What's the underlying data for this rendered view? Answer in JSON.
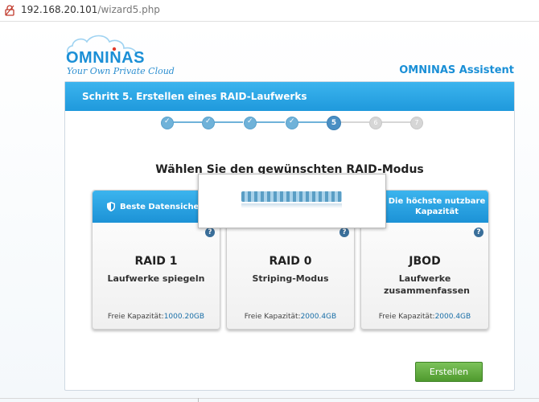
{
  "browser": {
    "url_host": "192.168.20.101",
    "url_path": "/wizard5.php"
  },
  "header": {
    "logo_text": "OMNINAS",
    "tagline": "Your Own Private Cloud",
    "assistant_title": "OMNINAS Assistent"
  },
  "wizard": {
    "step_title": "Schritt 5. Erstellen eines RAID-Laufwerks",
    "steps": [
      {
        "label": "✓",
        "state": "done"
      },
      {
        "label": "✓",
        "state": "done"
      },
      {
        "label": "✓",
        "state": "done"
      },
      {
        "label": "✓",
        "state": "done"
      },
      {
        "label": "5",
        "state": "current"
      },
      {
        "label": "6",
        "state": "todo"
      },
      {
        "label": "7",
        "state": "todo"
      }
    ],
    "mode_title": "Wählen Sie den gewünschten RAID-Modus"
  },
  "cards": [
    {
      "header": "Beste Datensicherh",
      "name": "RAID 1",
      "desc": "Laufwerke spiegeln",
      "cap_label": "Freie Kapazität:",
      "cap_value": "1000.20GB",
      "help": "?"
    },
    {
      "header": "",
      "name": "RAID 0",
      "desc": "Striping-Modus",
      "cap_label": "Freie Kapazität:",
      "cap_value": "2000.4GB",
      "help": "?"
    },
    {
      "header": "Die höchste nutzbare Kapazität",
      "name": "JBOD",
      "desc": "Laufwerke zusammenfassen",
      "cap_label": "Freie Kapazität:",
      "cap_value": "2000.4GB",
      "help": "?"
    }
  ],
  "actions": {
    "create_label": "Erstellen"
  },
  "colors": {
    "accent": "#1a8fd6",
    "header_blue": "#2aa7e6",
    "create_green": "#5fad3c"
  }
}
